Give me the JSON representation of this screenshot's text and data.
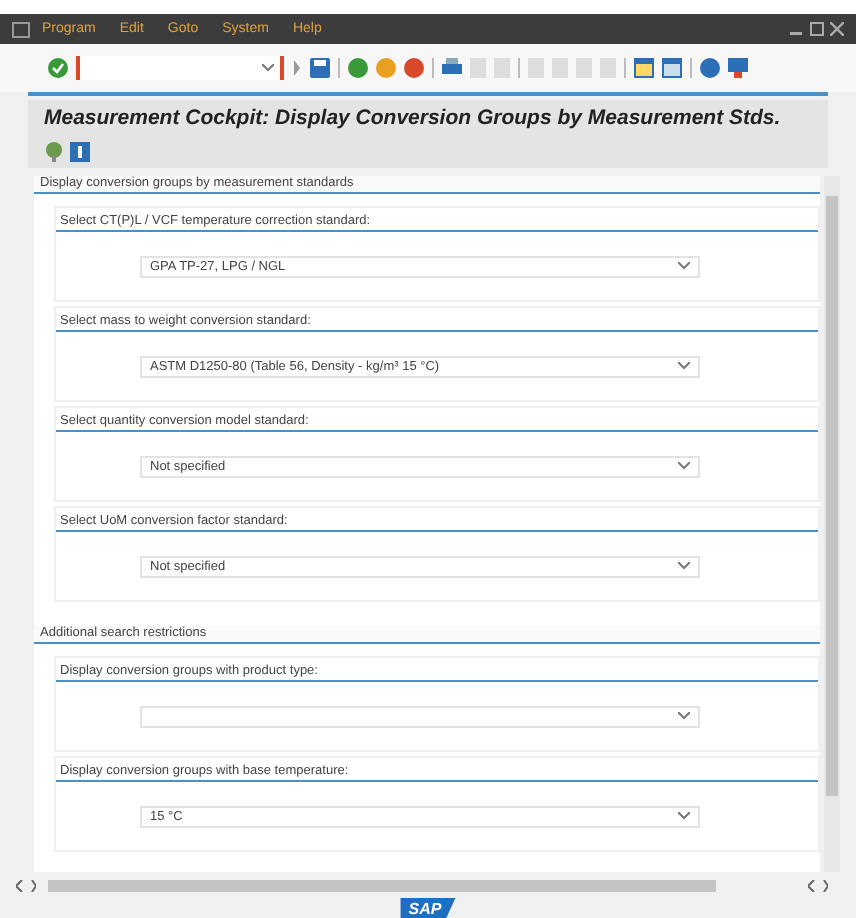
{
  "menu_bar": {
    "items": [
      "Program",
      "Edit",
      "Goto",
      "System",
      "Help"
    ]
  },
  "title": "Measurement Cockpit: Display Conversion Groups by Measurement Stds.",
  "sections": [
    {
      "heading": "Display conversion groups by measurement standards",
      "fields": [
        {
          "label": "Select CT(P)L / VCF temperature correction standard:",
          "value": "GPA TP-27, LPG / NGL"
        },
        {
          "label": "Select mass to weight conversion standard:",
          "value": "ASTM D1250-80 (Table 56, Density - kg/m³ 15 °C)"
        },
        {
          "label": "Select quantity conversion model standard:",
          "value": "Not specified"
        },
        {
          "label": "Select UoM conversion factor standard:",
          "value": "Not specified"
        }
      ]
    },
    {
      "heading": "Additional search restrictions",
      "fields": [
        {
          "label": "Display conversion groups with product type:"
        },
        {
          "label": "Display conversion groups with base temperature:",
          "value": "15 °C"
        }
      ]
    }
  ],
  "logo": "SAP"
}
